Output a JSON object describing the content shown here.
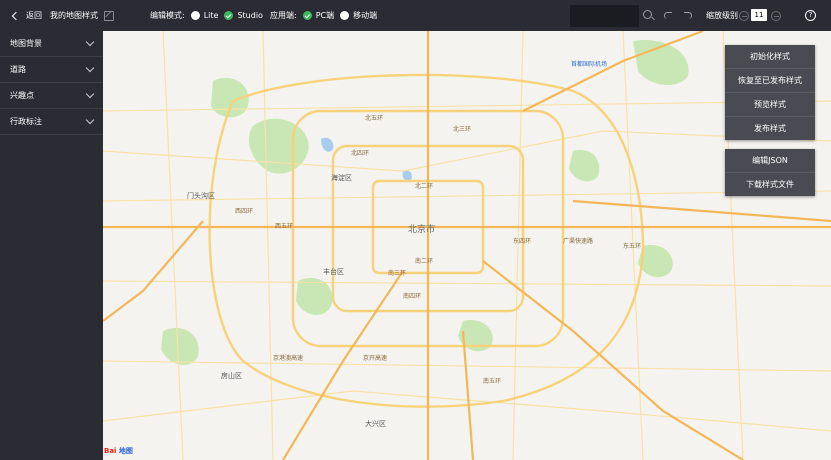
{
  "topbar": {
    "back_label": "返回",
    "map_title": "我的地图样式",
    "edit_mode_label": "编辑模式:",
    "modes": [
      {
        "label": "Lite",
        "selected": false
      },
      {
        "label": "Studio",
        "selected": true
      }
    ],
    "apply_label": "应用端:",
    "platforms": [
      {
        "label": "PC端",
        "selected": true
      },
      {
        "label": "移动端",
        "selected": false
      }
    ],
    "search_value": "",
    "zoom_label": "缩放级别",
    "zoom_value": "11"
  },
  "sidebar": {
    "items": [
      {
        "label": "地图背景"
      },
      {
        "label": "道路"
      },
      {
        "label": "兴趣点"
      },
      {
        "label": "行政标注"
      }
    ]
  },
  "actions": {
    "init_style": "初始化样式",
    "restore_published": "恢复至已发布样式",
    "preview_style": "预览样式",
    "publish_style": "发布样式",
    "edit_json": "编辑JSON",
    "download_style": "下载样式文件"
  },
  "map": {
    "city_label": "北京市",
    "district_labels": [
      "海淀区",
      "门头沟区",
      "丰台区",
      "房山区",
      "大兴区"
    ],
    "road_labels": [
      "北五环",
      "北四环",
      "北三环",
      "北二环",
      "西五环",
      "西四环",
      "南二环",
      "南三环",
      "南四环",
      "南五环",
      "东五环",
      "东四环",
      "广渠快速路",
      "京开高速",
      "京港澳高速",
      "首都国际机场"
    ],
    "logo_text": "Bai",
    "logo_text2": "地图"
  },
  "colors": {
    "topbar_bg": "#2a2b33",
    "map_bg": "#f4f3ef",
    "road_yellow": "#f8d27a",
    "road_main": "#f3b758",
    "park_green": "#c9e7b4",
    "water_blue": "#a9cdf0",
    "check_green": "#3cb95a"
  }
}
